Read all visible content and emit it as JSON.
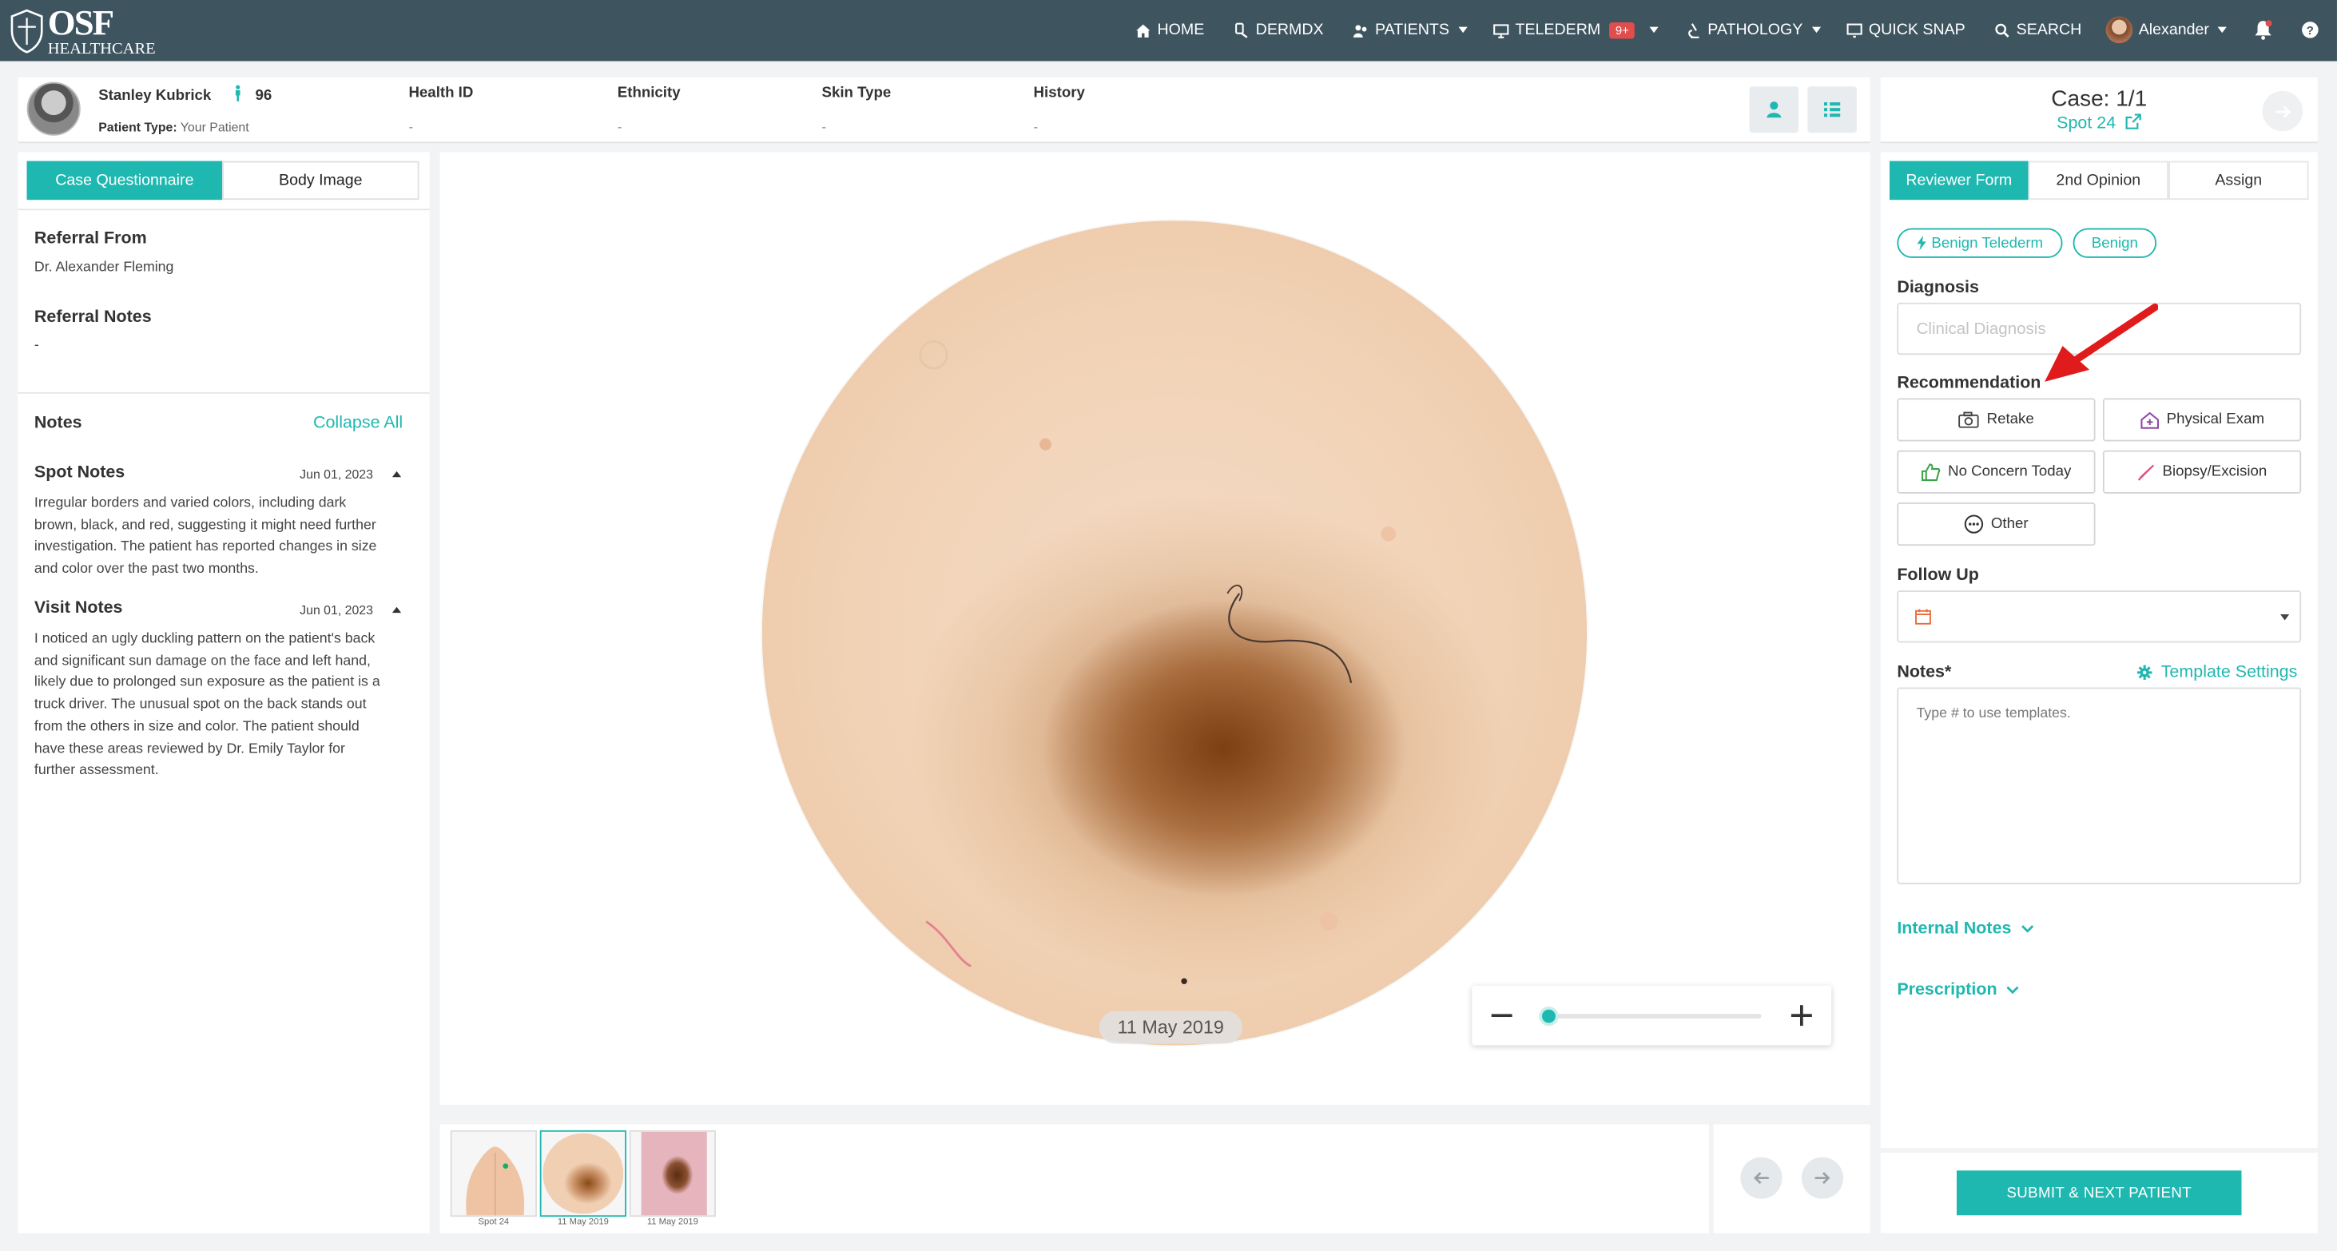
{
  "app": {
    "logo_main": "OSF",
    "logo_sub": "HEALTHCARE"
  },
  "nav": {
    "home": "HOME",
    "dermdx": "DERMDX",
    "patients": "PATIENTS",
    "telederm": "TELEDERM",
    "telederm_badge": "9+",
    "pathology": "PATHOLOGY",
    "quick_snap": "QUICK SNAP",
    "search": "SEARCH",
    "user": "Alexander"
  },
  "patient": {
    "name": "Stanley Kubrick",
    "age": "96",
    "type_label": "Patient Type:",
    "type_value": "Your Patient",
    "health_id_label": "Health ID",
    "health_id_value": "-",
    "ethnicity_label": "Ethnicity",
    "ethnicity_value": "-",
    "skin_type_label": "Skin Type",
    "skin_type_value": "-",
    "history_label": "History",
    "history_value": "-"
  },
  "case": {
    "title": "Case: 1/1",
    "spot": "Spot 24"
  },
  "left": {
    "tab_questionnaire": "Case Questionnaire",
    "tab_body_image": "Body Image",
    "referral_from_label": "Referral From",
    "referral_from_value": "Dr. Alexander Fleming",
    "referral_notes_label": "Referral Notes",
    "referral_notes_value": "-",
    "notes_label": "Notes",
    "collapse_all": "Collapse All",
    "spot_notes": {
      "title": "Spot Notes",
      "date": "Jun 01, 2023",
      "lines": [
        "Irregular borders and varied colors, including dark",
        "brown, black, and red, suggesting it might need further",
        "investigation. The patient has reported changes in size",
        "and color over the past two months."
      ]
    },
    "visit_notes": {
      "title": "Visit Notes",
      "date": "Jun 01, 2023",
      "lines": [
        "I noticed an ugly duckling pattern on the patient's back",
        "and significant sun damage on the face and left hand,",
        "likely due to prolonged sun exposure as the patient is a",
        "truck driver. The unusual spot on the back stands out",
        "from the others in size and color. The patient should",
        "have these areas reviewed by Dr. Emily Taylor for",
        "further assessment."
      ]
    }
  },
  "viewer": {
    "date": "11 May 2019",
    "zoom_level": 0.0
  },
  "thumbs": [
    {
      "label": "Spot 24"
    },
    {
      "label": "11 May 2019"
    },
    {
      "label": "11 May 2019"
    }
  ],
  "right": {
    "tab_reviewer": "Reviewer Form",
    "tab_second": "2nd Opinion",
    "tab_assign": "Assign",
    "chip_telederm": "Benign Telederm",
    "chip_benign": "Benign",
    "diagnosis_label": "Diagnosis",
    "diagnosis_placeholder": "Clinical Diagnosis",
    "recommendation_label": "Recommendation",
    "rec_retake": "Retake",
    "rec_physical": "Physical Exam",
    "rec_no_concern": "No Concern Today",
    "rec_biopsy": "Biopsy/Excision",
    "rec_other": "Other",
    "follow_up_label": "Follow Up",
    "notes_label": "Notes*",
    "template_settings": "Template Settings",
    "notes_placeholder": "Type # to use templates.",
    "internal_notes": "Internal Notes",
    "prescription": "Prescription",
    "submit": "SUBMIT & NEXT PATIENT"
  },
  "colors": {
    "accent": "#1fb8b0",
    "nav_bg": "#3e5560",
    "badge": "#e14c4c",
    "arrow": "#e01b1b"
  }
}
